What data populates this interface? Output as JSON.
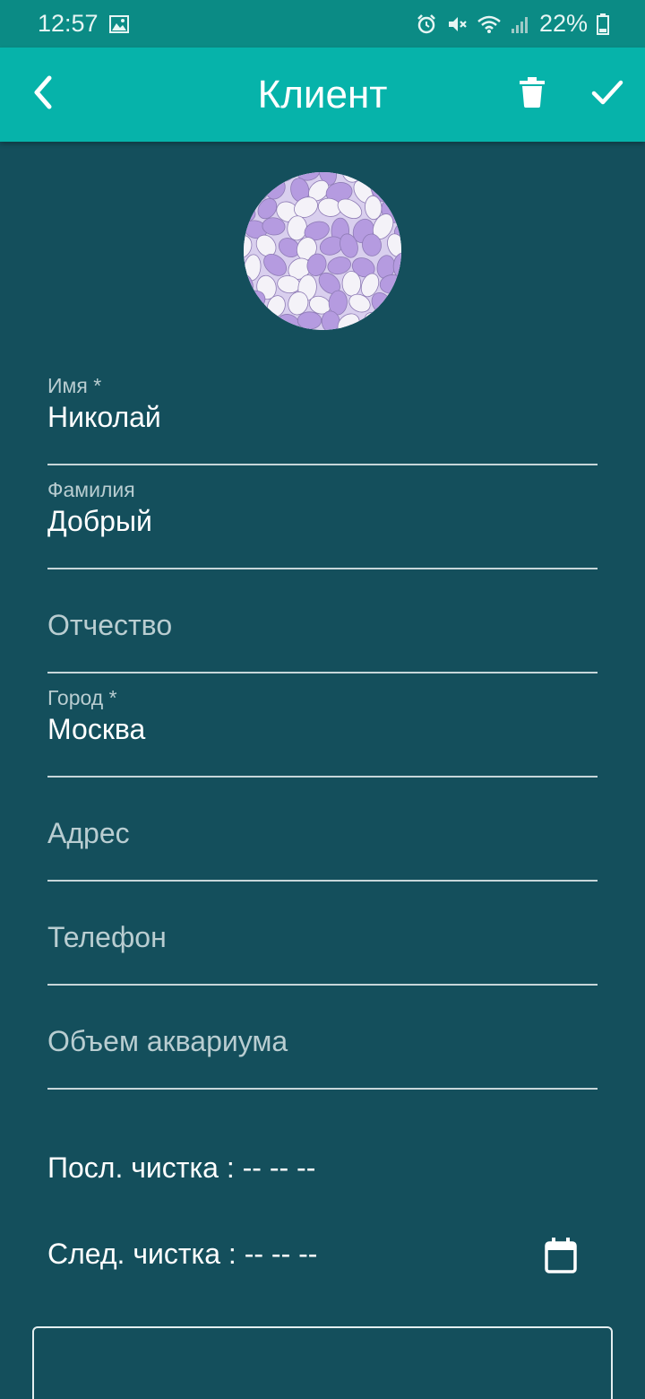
{
  "status_bar": {
    "time": "12:57",
    "battery": "22%",
    "icons": [
      "image-icon",
      "alarm-icon",
      "mute-icon",
      "wifi-icon",
      "signal-icon",
      "battery-icon"
    ]
  },
  "app_bar": {
    "title": "Клиент",
    "back_icon": "chevron-left-icon",
    "delete_icon": "trash-icon",
    "save_icon": "check-icon"
  },
  "form": {
    "first_name": {
      "label": "Имя *",
      "value": "Николай"
    },
    "last_name": {
      "label": "Фамилия",
      "value": "Добрый"
    },
    "patronymic": {
      "placeholder": "Отчество"
    },
    "city": {
      "label": "Город *",
      "value": "Москва"
    },
    "address": {
      "placeholder": "Адрес"
    },
    "phone": {
      "placeholder": "Телефон"
    },
    "tank_volume": {
      "placeholder": "Объем аквариума"
    }
  },
  "cleaning": {
    "last": "Посл. чистка : -- -- --",
    "next": "След. чистка : -- -- --",
    "calendar_icon": "calendar-icon"
  },
  "colors": {
    "status_bar": "#0b8b85",
    "app_bar": "#06b3aa",
    "background": "#144f5c",
    "candy_purple": "#b59be0",
    "candy_white": "#f4f2f8"
  }
}
